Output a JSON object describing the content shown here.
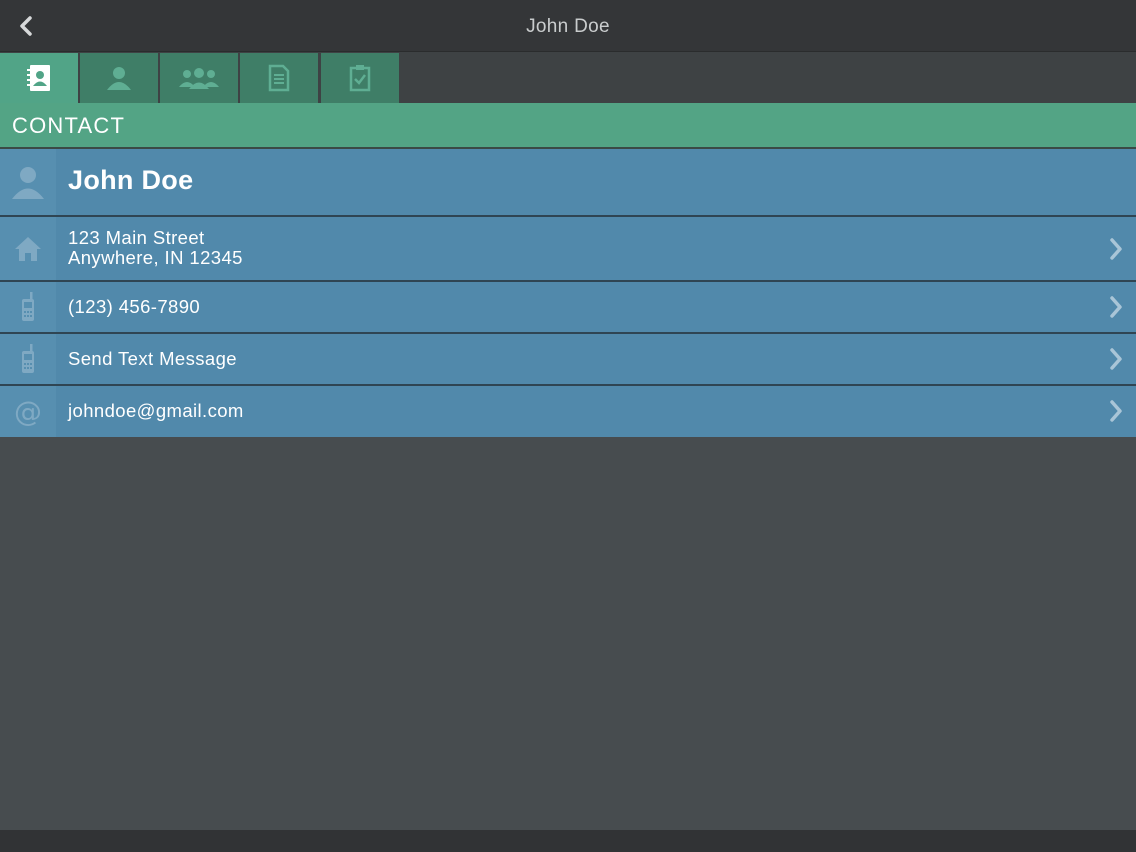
{
  "navbar": {
    "title": "John Doe",
    "back_icon": "chevron-left-icon"
  },
  "tabs": [
    {
      "icon": "address-book-icon",
      "active": true
    },
    {
      "icon": "person-icon",
      "active": false
    },
    {
      "icon": "group-icon",
      "active": false
    },
    {
      "icon": "document-icon",
      "active": false
    },
    {
      "icon": "clipboard-check-icon",
      "active": false
    }
  ],
  "section": {
    "title": "CONTACT"
  },
  "contact": {
    "name": "John Doe",
    "address_line1": "123 Main Street",
    "address_line2": "Anywhere, IN 12345",
    "phone": "(123) 456-7890",
    "text_message_label": "Send Text Message",
    "email": "johndoe@gmail.com"
  },
  "colors": {
    "navbar": "#343638",
    "tab_inactive": "#3f7e67",
    "tab_active": "#51a487",
    "section_header": "#53a485",
    "row": "#5189ab",
    "background": "#474c4f"
  }
}
